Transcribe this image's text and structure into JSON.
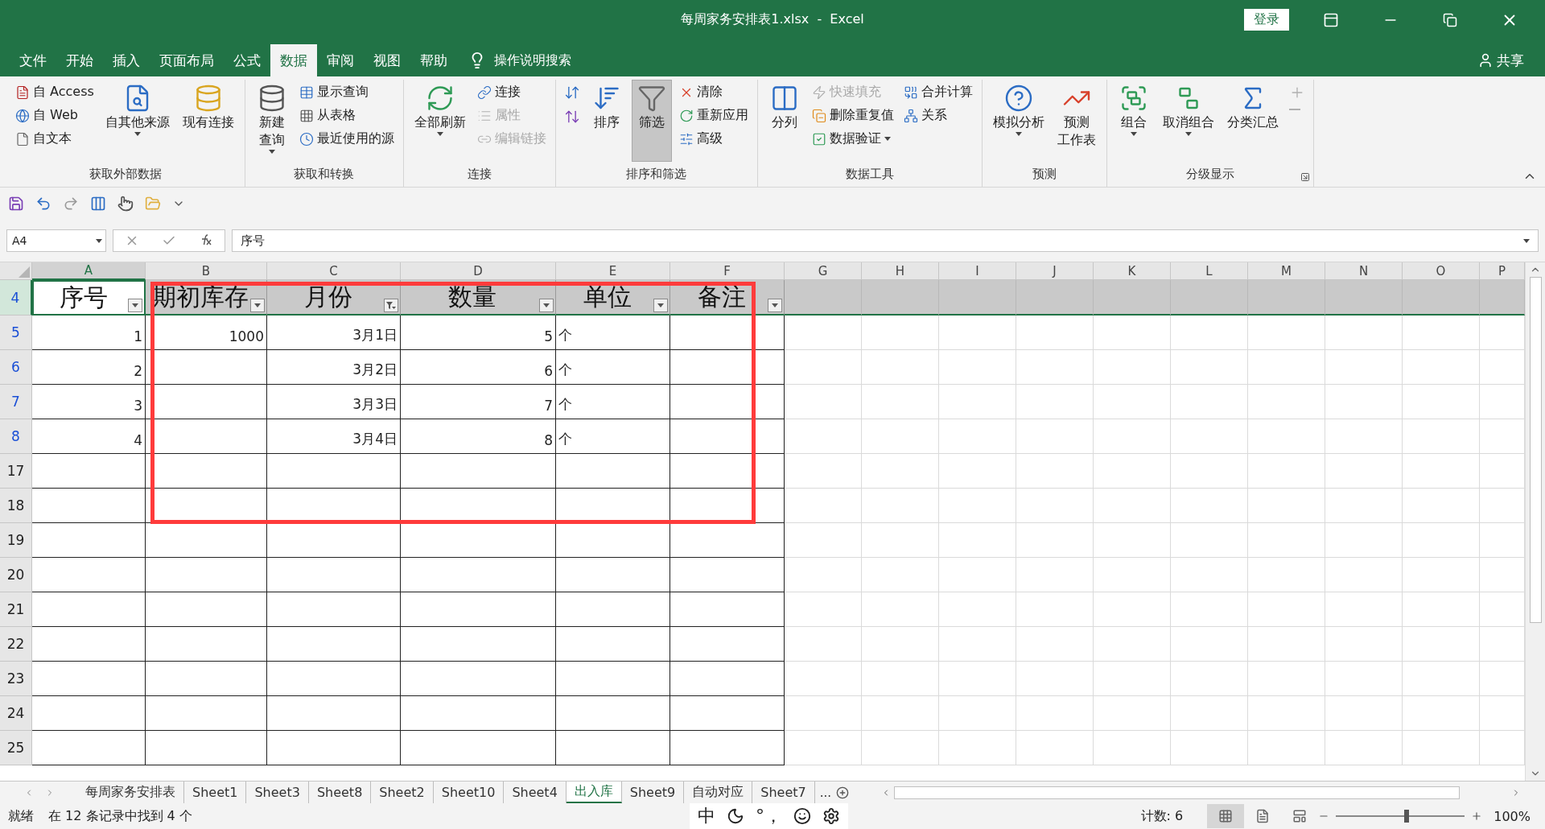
{
  "window": {
    "title": "每周家务安排表1.xlsx  -  Excel",
    "sign_in": "登录"
  },
  "menu": {
    "tabs": [
      {
        "label": "文件",
        "selected": false
      },
      {
        "label": "开始",
        "selected": false
      },
      {
        "label": "插入",
        "selected": false
      },
      {
        "label": "页面布局",
        "selected": false
      },
      {
        "label": "公式",
        "selected": false
      },
      {
        "label": "数据",
        "selected": true
      },
      {
        "label": "审阅",
        "selected": false
      },
      {
        "label": "视图",
        "selected": false
      },
      {
        "label": "帮助",
        "selected": false
      }
    ],
    "search": "操作说明搜索",
    "share": "共享"
  },
  "ribbon": {
    "groups": [
      {
        "label": "获取外部数据",
        "items": [
          {
            "kind": "stack",
            "buttons": [
              {
                "label": "自 Access",
                "disabled": false
              },
              {
                "label": "自 Web",
                "disabled": false
              },
              {
                "label": "自文本",
                "disabled": false
              }
            ]
          },
          {
            "kind": "large",
            "lines": [
              "自其他来源"
            ],
            "dropdown": true,
            "selected": false,
            "disabled": false
          },
          {
            "kind": "large",
            "lines": [
              "现有连接"
            ],
            "dropdown": false,
            "selected": false,
            "disabled": false
          }
        ]
      },
      {
        "label": "获取和转换",
        "items": [
          {
            "kind": "large",
            "lines": [
              "新建",
              "查询"
            ],
            "dropdown": true,
            "selected": false,
            "disabled": false
          },
          {
            "kind": "stack",
            "buttons": [
              {
                "label": "显示查询",
                "disabled": false
              },
              {
                "label": "从表格",
                "disabled": false
              },
              {
                "label": "最近使用的源",
                "disabled": false
              }
            ]
          }
        ]
      },
      {
        "label": "连接",
        "items": [
          {
            "kind": "large",
            "lines": [
              "全部刷新"
            ],
            "dropdown": true,
            "selected": false,
            "disabled": false
          },
          {
            "kind": "stack",
            "buttons": [
              {
                "label": "连接",
                "disabled": false
              },
              {
                "label": "属性",
                "disabled": true
              },
              {
                "label": "编辑链接",
                "disabled": true
              }
            ]
          }
        ]
      },
      {
        "label": "排序和筛选",
        "items": [
          {
            "kind": "icon_stack",
            "buttons": [
              {
                "disabled": false
              },
              {
                "disabled": false
              }
            ]
          },
          {
            "kind": "large",
            "lines": [
              "排序"
            ],
            "dropdown": false,
            "selected": false,
            "disabled": false
          },
          {
            "kind": "large",
            "lines": [
              "筛选"
            ],
            "dropdown": false,
            "selected": true,
            "disabled": false
          },
          {
            "kind": "stack",
            "buttons": [
              {
                "label": "清除",
                "disabled": false
              },
              {
                "label": "重新应用",
                "disabled": false
              },
              {
                "label": "高级",
                "disabled": false
              }
            ]
          }
        ]
      },
      {
        "label": "数据工具",
        "items": [
          {
            "kind": "large",
            "lines": [
              "分列"
            ],
            "dropdown": false,
            "selected": false,
            "disabled": false
          },
          {
            "kind": "stack",
            "buttons": [
              {
                "label": "快速填充",
                "disabled": true
              },
              {
                "label": "删除重复值",
                "disabled": false
              },
              {
                "label": "数据验证",
                "disabled": false,
                "dropdown": true
              }
            ]
          },
          {
            "kind": "stack",
            "buttons": [
              {
                "label": "合并计算",
                "disabled": false
              },
              {
                "label": "关系",
                "disabled": false
              }
            ]
          }
        ]
      },
      {
        "label": "预测",
        "items": [
          {
            "kind": "large",
            "lines": [
              "模拟分析"
            ],
            "dropdown": true,
            "selected": false,
            "disabled": false
          },
          {
            "kind": "large",
            "lines": [
              "预测",
              "工作表"
            ],
            "dropdown": false,
            "selected": false,
            "disabled": false
          }
        ]
      },
      {
        "label": "分级显示",
        "launcher": true,
        "items": [
          {
            "kind": "large",
            "lines": [
              "组合"
            ],
            "dropdown": true,
            "selected": false,
            "disabled": false
          },
          {
            "kind": "large",
            "lines": [
              "取消组合"
            ],
            "dropdown": true,
            "selected": false,
            "disabled": false
          },
          {
            "kind": "large",
            "lines": [
              "分类汇总"
            ],
            "dropdown": false,
            "selected": false,
            "disabled": false
          },
          {
            "kind": "icon_stack",
            "buttons": [
              {
                "disabled": true
              },
              {
                "disabled": true
              }
            ]
          }
        ]
      }
    ]
  },
  "formula_bar": {
    "name_box": "A4",
    "formula": "序号"
  },
  "sheet": {
    "columns": [
      {
        "letter": "A",
        "selected": true
      },
      {
        "letter": "B",
        "selected": false
      },
      {
        "letter": "C",
        "selected": false
      },
      {
        "letter": "D",
        "selected": false
      },
      {
        "letter": "E",
        "selected": false
      },
      {
        "letter": "F",
        "selected": false
      },
      {
        "letter": "G",
        "selected": false
      },
      {
        "letter": "H",
        "selected": false
      },
      {
        "letter": "I",
        "selected": false
      },
      {
        "letter": "J",
        "selected": false
      },
      {
        "letter": "K",
        "selected": false
      },
      {
        "letter": "L",
        "selected": false
      },
      {
        "letter": "M",
        "selected": false
      },
      {
        "letter": "N",
        "selected": false
      },
      {
        "letter": "O",
        "selected": false
      },
      {
        "letter": "P",
        "selected": false
      }
    ],
    "rows": [
      {
        "number": "4",
        "kind": "header",
        "filtered": true,
        "selected": true,
        "cells": {
          "A": {
            "text": "序号",
            "filter_applied": false,
            "selected": true
          },
          "B": {
            "text": "期初库存",
            "filter_applied": false,
            "selected": false
          },
          "C": {
            "text": "月份",
            "filter_applied": true,
            "selected": false
          },
          "D": {
            "text": "数量",
            "filter_applied": false,
            "selected": false
          },
          "E": {
            "text": "单位",
            "filter_applied": false,
            "selected": false
          },
          "F": {
            "text": "备注",
            "filter_applied": false,
            "selected": false
          }
        }
      },
      {
        "number": "5",
        "kind": "data",
        "filtered": true,
        "selected": false,
        "cells": {
          "A": "1",
          "B": "1000",
          "C": "3月1日",
          "D": "5",
          "E": "个"
        }
      },
      {
        "number": "6",
        "kind": "data",
        "filtered": true,
        "selected": false,
        "cells": {
          "A": "2",
          "C": "3月2日",
          "D": "6",
          "E": "个"
        }
      },
      {
        "number": "7",
        "kind": "data",
        "filtered": true,
        "selected": false,
        "cells": {
          "A": "3",
          "C": "3月3日",
          "D": "7",
          "E": "个"
        }
      },
      {
        "number": "8",
        "kind": "data",
        "filtered": true,
        "selected": false,
        "cells": {
          "A": "4",
          "C": "3月4日",
          "D": "8",
          "E": "个"
        }
      },
      {
        "number": "17",
        "kind": "data",
        "filtered": false,
        "selected": false
      },
      {
        "number": "18",
        "kind": "data",
        "filtered": false,
        "selected": false
      },
      {
        "number": "19",
        "kind": "data",
        "filtered": false,
        "selected": false
      },
      {
        "number": "20",
        "kind": "data",
        "filtered": false,
        "selected": false
      },
      {
        "number": "21",
        "kind": "data",
        "filtered": false,
        "selected": false
      },
      {
        "number": "22",
        "kind": "data",
        "filtered": false,
        "selected": false
      },
      {
        "number": "23",
        "kind": "data",
        "filtered": false,
        "selected": false
      },
      {
        "number": "24",
        "kind": "data",
        "filtered": false,
        "selected": false
      },
      {
        "number": "25",
        "kind": "data",
        "filtered": false,
        "selected": false
      }
    ],
    "highlight_box": true
  },
  "sheet_tabs": [
    {
      "label": "每周家务安排表",
      "selected": false
    },
    {
      "label": "Sheet1",
      "selected": false
    },
    {
      "label": "Sheet3",
      "selected": false
    },
    {
      "label": "Sheet8",
      "selected": false
    },
    {
      "label": "Sheet2",
      "selected": false
    },
    {
      "label": "Sheet10",
      "selected": false
    },
    {
      "label": "Sheet4",
      "selected": false
    },
    {
      "label": "出入库",
      "selected": true
    },
    {
      "label": "Sheet9",
      "selected": false
    },
    {
      "label": "自动对应",
      "selected": false
    },
    {
      "label": "Sheet7",
      "selected": false
    }
  ],
  "more_tabs": "...",
  "status_bar": {
    "mode": "就绪",
    "message": "在 12 条记录中找到 4 个",
    "ime_language": "中",
    "ime_punctuation": "°，",
    "count": "计数: 6",
    "zoom": {
      "level": 0.55,
      "text": "100%"
    }
  }
}
